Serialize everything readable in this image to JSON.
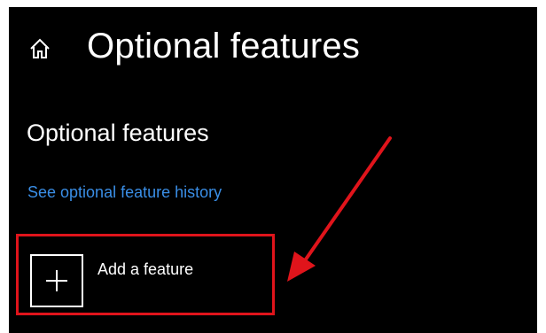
{
  "header": {
    "home_icon": "home-icon",
    "title": "Optional features"
  },
  "main": {
    "section_title": "Optional features",
    "history_link": "See optional feature history",
    "add_feature": {
      "icon": "plus-icon",
      "label": "Add a feature"
    }
  },
  "colors": {
    "background": "#000000",
    "link": "#3a8ee6",
    "highlight": "#e0141b",
    "text": "#ffffff"
  }
}
